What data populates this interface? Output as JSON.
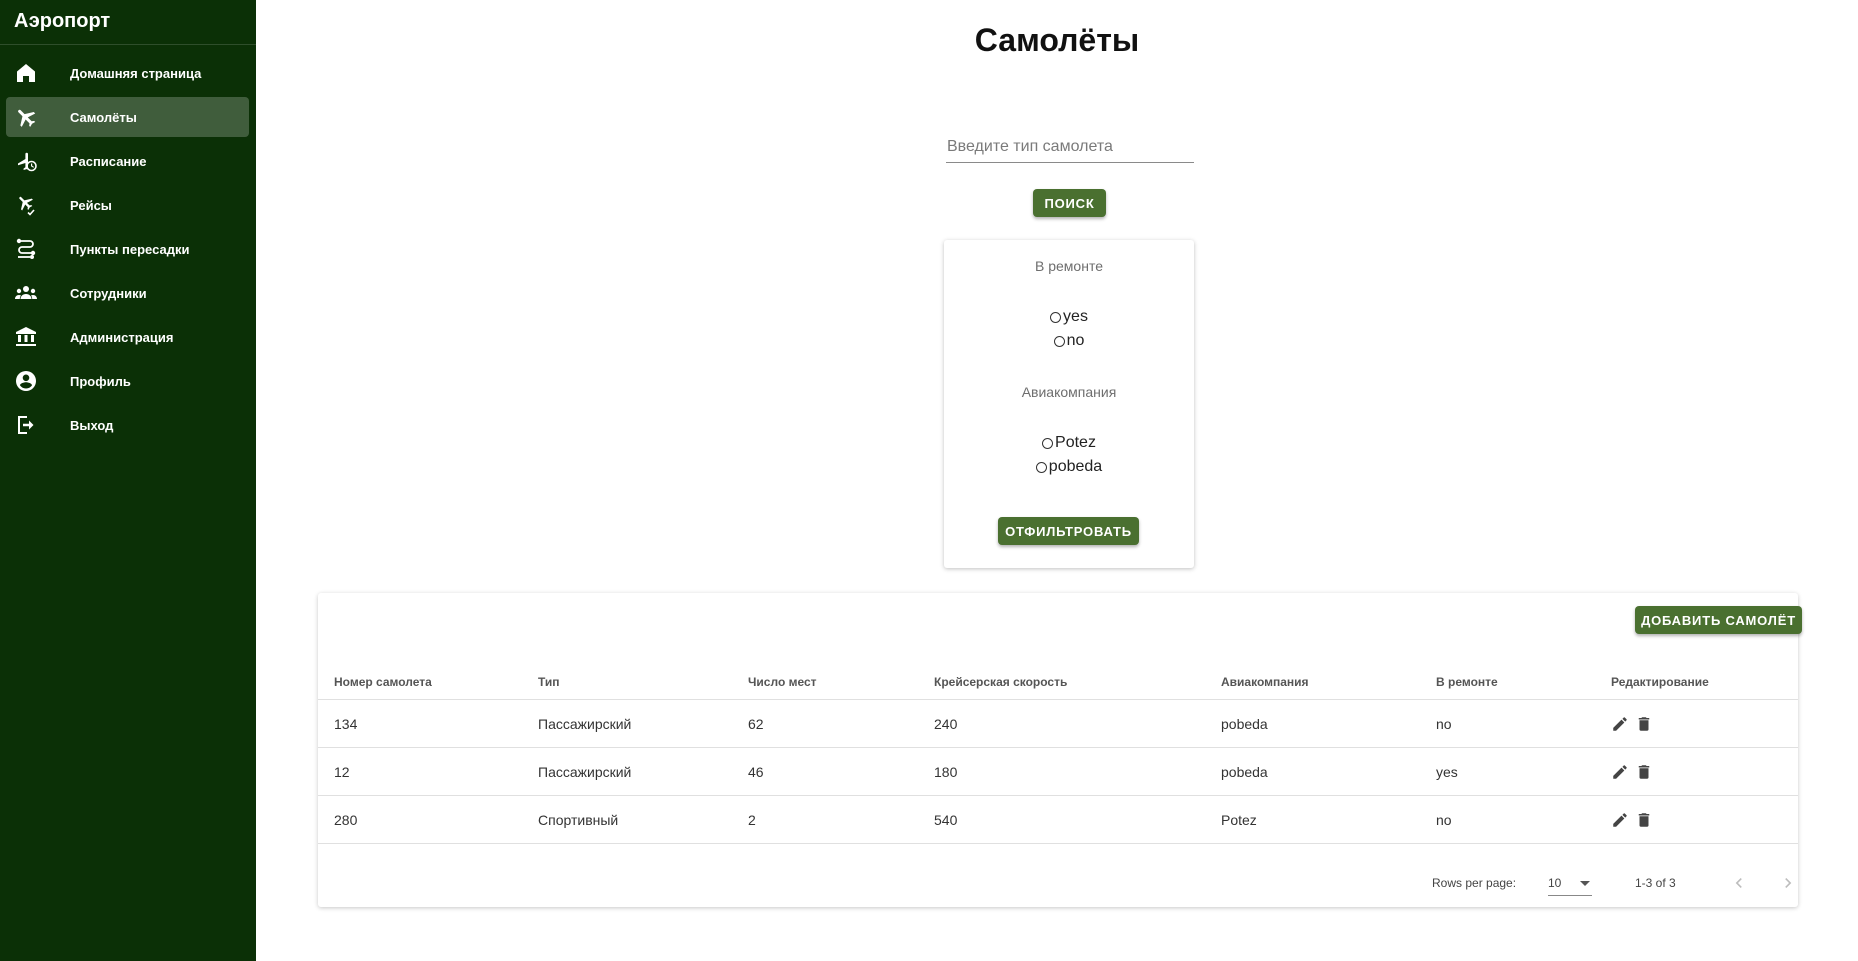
{
  "app": {
    "title": "Аэропорт"
  },
  "sidebar": {
    "items": [
      {
        "label": "Домашняя страница",
        "icon": "home-icon",
        "active": false
      },
      {
        "label": "Самолёты",
        "icon": "airplane-icon",
        "active": true
      },
      {
        "label": "Расписание",
        "icon": "schedule-plane-icon",
        "active": false
      },
      {
        "label": "Рейсы",
        "icon": "flight-check-icon",
        "active": false
      },
      {
        "label": "Пункты пересадки",
        "icon": "route-icon",
        "active": false
      },
      {
        "label": "Сотрудники",
        "icon": "people-icon",
        "active": false
      },
      {
        "label": "Администрация",
        "icon": "building-icon",
        "active": false
      },
      {
        "label": "Профиль",
        "icon": "account-icon",
        "active": false
      },
      {
        "label": "Выход",
        "icon": "logout-icon",
        "active": false
      }
    ]
  },
  "page": {
    "title": "Самолёты"
  },
  "search": {
    "placeholder": "Введите тип самолета",
    "value": "",
    "button_label": "Поиск"
  },
  "filter": {
    "groups": [
      {
        "heading": "В ремонте",
        "options": [
          "yes",
          "no"
        ]
      },
      {
        "heading": "Авиакомпания",
        "options": [
          "Potez",
          "pobeda"
        ]
      }
    ],
    "button_label": "Отфильтровать"
  },
  "table": {
    "add_button_label": "Добавить самолёт",
    "columns": [
      "Номер самолета",
      "Тип",
      "Число мест",
      "Крейсерская скорость",
      "Авиакомпания",
      "В ремонте",
      "Редактирование"
    ],
    "rows": [
      [
        "134",
        "Пассажирский",
        "62",
        "240",
        "pobeda",
        "no"
      ],
      [
        "12",
        "Пассажирский",
        "46",
        "180",
        "pobeda",
        "yes"
      ],
      [
        "280",
        "Спортивный",
        "2",
        "540",
        "Potez",
        "no"
      ]
    ],
    "row_actions": [
      "edit-icon",
      "delete-icon"
    ]
  },
  "pagination": {
    "rows_per_page_label": "Rows per page:",
    "rows_per_page": "10",
    "range": "1-3 of 3"
  },
  "colors": {
    "sidebar_bg": "#0b3006",
    "accent": "#4a7030"
  }
}
